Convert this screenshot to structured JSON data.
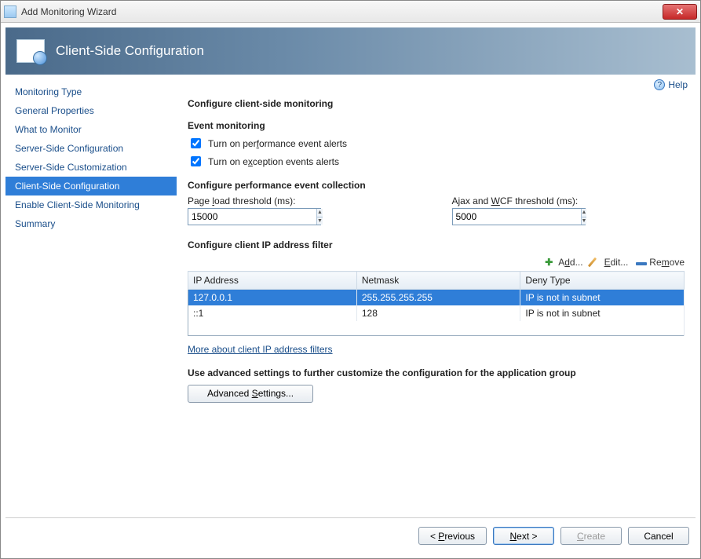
{
  "window": {
    "title": "Add Monitoring Wizard"
  },
  "banner": {
    "title": "Client-Side Configuration"
  },
  "help": {
    "label": "Help"
  },
  "sidebar": {
    "items": [
      {
        "label": "Monitoring Type"
      },
      {
        "label": "General Properties"
      },
      {
        "label": "What to Monitor"
      },
      {
        "label": "Server-Side Configuration"
      },
      {
        "label": "Server-Side Customization"
      },
      {
        "label": "Client-Side Configuration"
      },
      {
        "label": "Enable Client-Side Monitoring"
      },
      {
        "label": "Summary"
      }
    ],
    "selected_index": 5
  },
  "content": {
    "configure_title": "Configure client-side monitoring",
    "event_monitoring_title": "Event monitoring",
    "perf_alerts": {
      "label_pre": "Turn on per",
      "label_u": "f",
      "label_post": "ormance event alerts",
      "checked": true
    },
    "exc_alerts": {
      "label_pre": "Turn on e",
      "label_u": "x",
      "label_post": "ception events alerts",
      "checked": true
    },
    "perf_collection_title": "Configure performance event collection",
    "page_load": {
      "label_pre": "Page ",
      "label_u": "l",
      "label_post": "oad threshold (ms):",
      "value": "15000"
    },
    "ajax_wcf": {
      "label_pre": "Ajax and ",
      "label_u": "W",
      "label_post": "CF threshold (ms):",
      "value": "5000"
    },
    "ip_filter_title": "Configure client IP address filter",
    "toolbar": {
      "add": {
        "label_pre": "A",
        "label_u": "d",
        "label_post": "d..."
      },
      "edit": {
        "label_u": "E",
        "label_post": "dit..."
      },
      "remove": {
        "label_pre": "Re",
        "label_u": "m",
        "label_post": "ove"
      }
    },
    "grid": {
      "headers": {
        "ip": "IP Address",
        "mask": "Netmask",
        "deny": "Deny Type"
      },
      "rows": [
        {
          "ip": "127.0.0.1",
          "mask": "255.255.255.255",
          "deny": "IP is not in subnet",
          "selected": true
        },
        {
          "ip": "::1",
          "mask": "128",
          "deny": "IP is not in subnet",
          "selected": false
        }
      ]
    },
    "more_link": "More about client IP address filters",
    "advanced_hint": "Use advanced settings to further customize the configuration for the application group",
    "advanced_button": {
      "pre": "Advanced ",
      "u": "S",
      "post": "ettings..."
    }
  },
  "footer": {
    "previous": {
      "sym": "< ",
      "u": "P",
      "post": "revious"
    },
    "next": {
      "u": "N",
      "post": "ext ",
      "sym": ">"
    },
    "create": {
      "u": "C",
      "post": "reate"
    },
    "cancel": {
      "label": "Cancel"
    }
  }
}
